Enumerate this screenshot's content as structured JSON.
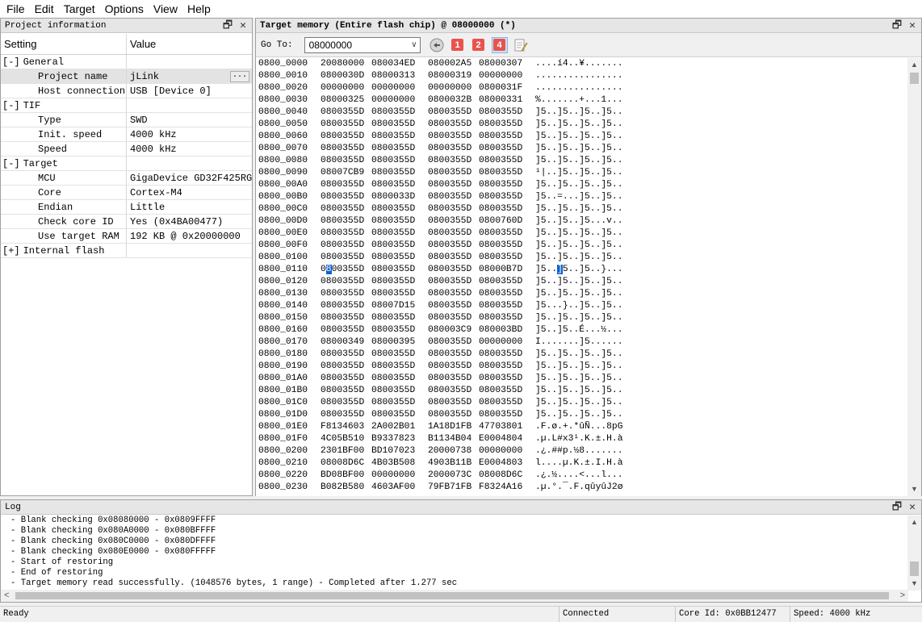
{
  "menu": [
    "File",
    "Edit",
    "Target",
    "Options",
    "View",
    "Help"
  ],
  "project_pane": {
    "title": "Project information",
    "col_setting": "Setting",
    "col_value": "Value",
    "rows": [
      {
        "kind": "group",
        "toggle": "[-]",
        "label": "General",
        "value": ""
      },
      {
        "kind": "item",
        "label": "Project name",
        "value": "jLink",
        "selected": true,
        "button": "..."
      },
      {
        "kind": "item",
        "label": "Host connection",
        "value": "USB [Device 0]"
      },
      {
        "kind": "group",
        "toggle": "[-]",
        "label": "TIF",
        "value": ""
      },
      {
        "kind": "item",
        "label": "Type",
        "value": "SWD"
      },
      {
        "kind": "item",
        "label": "Init. speed",
        "value": "4000 kHz"
      },
      {
        "kind": "item",
        "label": "Speed",
        "value": "4000 kHz"
      },
      {
        "kind": "group",
        "toggle": "[-]",
        "label": "Target",
        "value": ""
      },
      {
        "kind": "item",
        "label": "MCU",
        "value": "GigaDevice GD32F425RG"
      },
      {
        "kind": "item",
        "label": "Core",
        "value": "Cortex-M4"
      },
      {
        "kind": "item",
        "label": "Endian",
        "value": "Little"
      },
      {
        "kind": "item",
        "label": "Check core ID",
        "value": "Yes (0x4BA00477)"
      },
      {
        "kind": "item",
        "label": "Use target RAM",
        "value": "192 KB @ 0x20000000"
      },
      {
        "kind": "group",
        "toggle": "[+]",
        "label": "Internal flash",
        "value": ""
      }
    ]
  },
  "memory_pane": {
    "title": "Target memory (Entire flash chip) @ 08000000 (*)",
    "goto_label": "Go To:",
    "goto_value": "08000000",
    "toolbar_badges": [
      "1",
      "2",
      "4"
    ],
    "rows": [
      [
        "0800_0000",
        "20080000",
        "080034ED",
        "080002A5",
        "08000307",
        "....í4..¥......."
      ],
      [
        "0800_0010",
        "0800030D",
        "08000313",
        "08000319",
        "00000000",
        "................"
      ],
      [
        "0800_0020",
        "00000000",
        "00000000",
        "00000000",
        "0800031F",
        "................"
      ],
      [
        "0800_0030",
        "08000325",
        "00000000",
        "0800032B",
        "08000331",
        "%.......+...1..."
      ],
      [
        "0800_0040",
        "0800355D",
        "0800355D",
        "0800355D",
        "0800355D",
        "]5..]5..]5..]5.."
      ],
      [
        "0800_0050",
        "0800355D",
        "0800355D",
        "0800355D",
        "0800355D",
        "]5..]5..]5..]5.."
      ],
      [
        "0800_0060",
        "0800355D",
        "0800355D",
        "0800355D",
        "0800355D",
        "]5..]5..]5..]5.."
      ],
      [
        "0800_0070",
        "0800355D",
        "0800355D",
        "0800355D",
        "0800355D",
        "]5..]5..]5..]5.."
      ],
      [
        "0800_0080",
        "0800355D",
        "0800355D",
        "0800355D",
        "0800355D",
        "]5..]5..]5..]5.."
      ],
      [
        "0800_0090",
        "08007CB9",
        "0800355D",
        "0800355D",
        "0800355D",
        "¹|..]5..]5..]5.."
      ],
      [
        "0800_00A0",
        "0800355D",
        "0800355D",
        "0800355D",
        "0800355D",
        "]5..]5..]5..]5.."
      ],
      [
        "0800_00B0",
        "0800355D",
        "0800033D",
        "0800355D",
        "0800355D",
        "]5..=...]5..]5.."
      ],
      [
        "0800_00C0",
        "0800355D",
        "0800355D",
        "0800355D",
        "0800355D",
        "]5..]5..]5..]5.."
      ],
      [
        "0800_00D0",
        "0800355D",
        "0800355D",
        "0800355D",
        "0800760D",
        "]5..]5..]5...v.."
      ],
      [
        "0800_00E0",
        "0800355D",
        "0800355D",
        "0800355D",
        "0800355D",
        "]5..]5..]5..]5.."
      ],
      [
        "0800_00F0",
        "0800355D",
        "0800355D",
        "0800355D",
        "0800355D",
        "]5..]5..]5..]5.."
      ],
      [
        "0800_0100",
        "0800355D",
        "0800355D",
        "0800355D",
        "0800355D",
        "]5..]5..]5..]5.."
      ],
      [
        "0800_0110",
        "0800355D",
        "0800355D",
        "0800355D",
        "08000B7D",
        "]5..]5..]5..}..."
      ],
      [
        "0800_0120",
        "0800355D",
        "0800355D",
        "0800355D",
        "0800355D",
        "]5..]5..]5..]5.."
      ],
      [
        "0800_0130",
        "0800355D",
        "0800355D",
        "0800355D",
        "0800355D",
        "]5..]5..]5..]5.."
      ],
      [
        "0800_0140",
        "0800355D",
        "08007D15",
        "0800355D",
        "0800355D",
        "]5...}..]5..]5.."
      ],
      [
        "0800_0150",
        "0800355D",
        "0800355D",
        "0800355D",
        "0800355D",
        "]5..]5..]5..]5.."
      ],
      [
        "0800_0160",
        "0800355D",
        "0800355D",
        "080003C9",
        "080003BD",
        "]5..]5..É...½..."
      ],
      [
        "0800_0170",
        "08000349",
        "08000395",
        "0800355D",
        "00000000",
        "I.......]5......"
      ],
      [
        "0800_0180",
        "0800355D",
        "0800355D",
        "0800355D",
        "0800355D",
        "]5..]5..]5..]5.."
      ],
      [
        "0800_0190",
        "0800355D",
        "0800355D",
        "0800355D",
        "0800355D",
        "]5..]5..]5..]5.."
      ],
      [
        "0800_01A0",
        "0800355D",
        "0800355D",
        "0800355D",
        "0800355D",
        "]5..]5..]5..]5.."
      ],
      [
        "0800_01B0",
        "0800355D",
        "0800355D",
        "0800355D",
        "0800355D",
        "]5..]5..]5..]5.."
      ],
      [
        "0800_01C0",
        "0800355D",
        "0800355D",
        "0800355D",
        "0800355D",
        "]5..]5..]5..]5.."
      ],
      [
        "0800_01D0",
        "0800355D",
        "0800355D",
        "0800355D",
        "0800355D",
        "]5..]5..]5..]5.."
      ],
      [
        "0800_01E0",
        "F8134603",
        "2A002B01",
        "1A18D1FB",
        "47703801",
        ".F.ø.+.*ûÑ...8pG"
      ],
      [
        "0800_01F0",
        "4C05B510",
        "B9337823",
        "B1134B04",
        "E0004804",
        ".µ.L#x3¹.K.±.H.à"
      ],
      [
        "0800_0200",
        "2301BF00",
        "BD107023",
        "20000738",
        "00000000",
        ".¿.##p.½8......."
      ],
      [
        "0800_0210",
        "08008D6C",
        "4B03B508",
        "4903B11B",
        "E0004803",
        "l....µ.K.±.I.H.à"
      ],
      [
        "0800_0220",
        "BD08BF00",
        "00000000",
        "2000073C",
        "08008D6C",
        ".¿.½....<...l..."
      ],
      [
        "0800_0230",
        "B082B580",
        "4603AF00",
        "79FB71FB",
        "F8324A16",
        ".µ.°.¯.F.qûyûJ2ø"
      ]
    ]
  },
  "log_pane": {
    "title": "Log",
    "lines": [
      "- Blank checking 0x08080000 - 0x0809FFFF",
      "- Blank checking 0x080A0000 - 0x080BFFFF",
      "- Blank checking 0x080C0000 - 0x080DFFFF",
      "- Blank checking 0x080E0000 - 0x080FFFFF",
      "- Start of restoring",
      "- End of restoring",
      "- Target memory read successfully. (1048576 bytes, 1 range) - Completed after 1.277 sec"
    ]
  },
  "status": {
    "ready": "Ready",
    "connection": "Connected",
    "core_id": "Core Id: 0x0BB12477",
    "speed": "Speed: 4000 kHz"
  }
}
